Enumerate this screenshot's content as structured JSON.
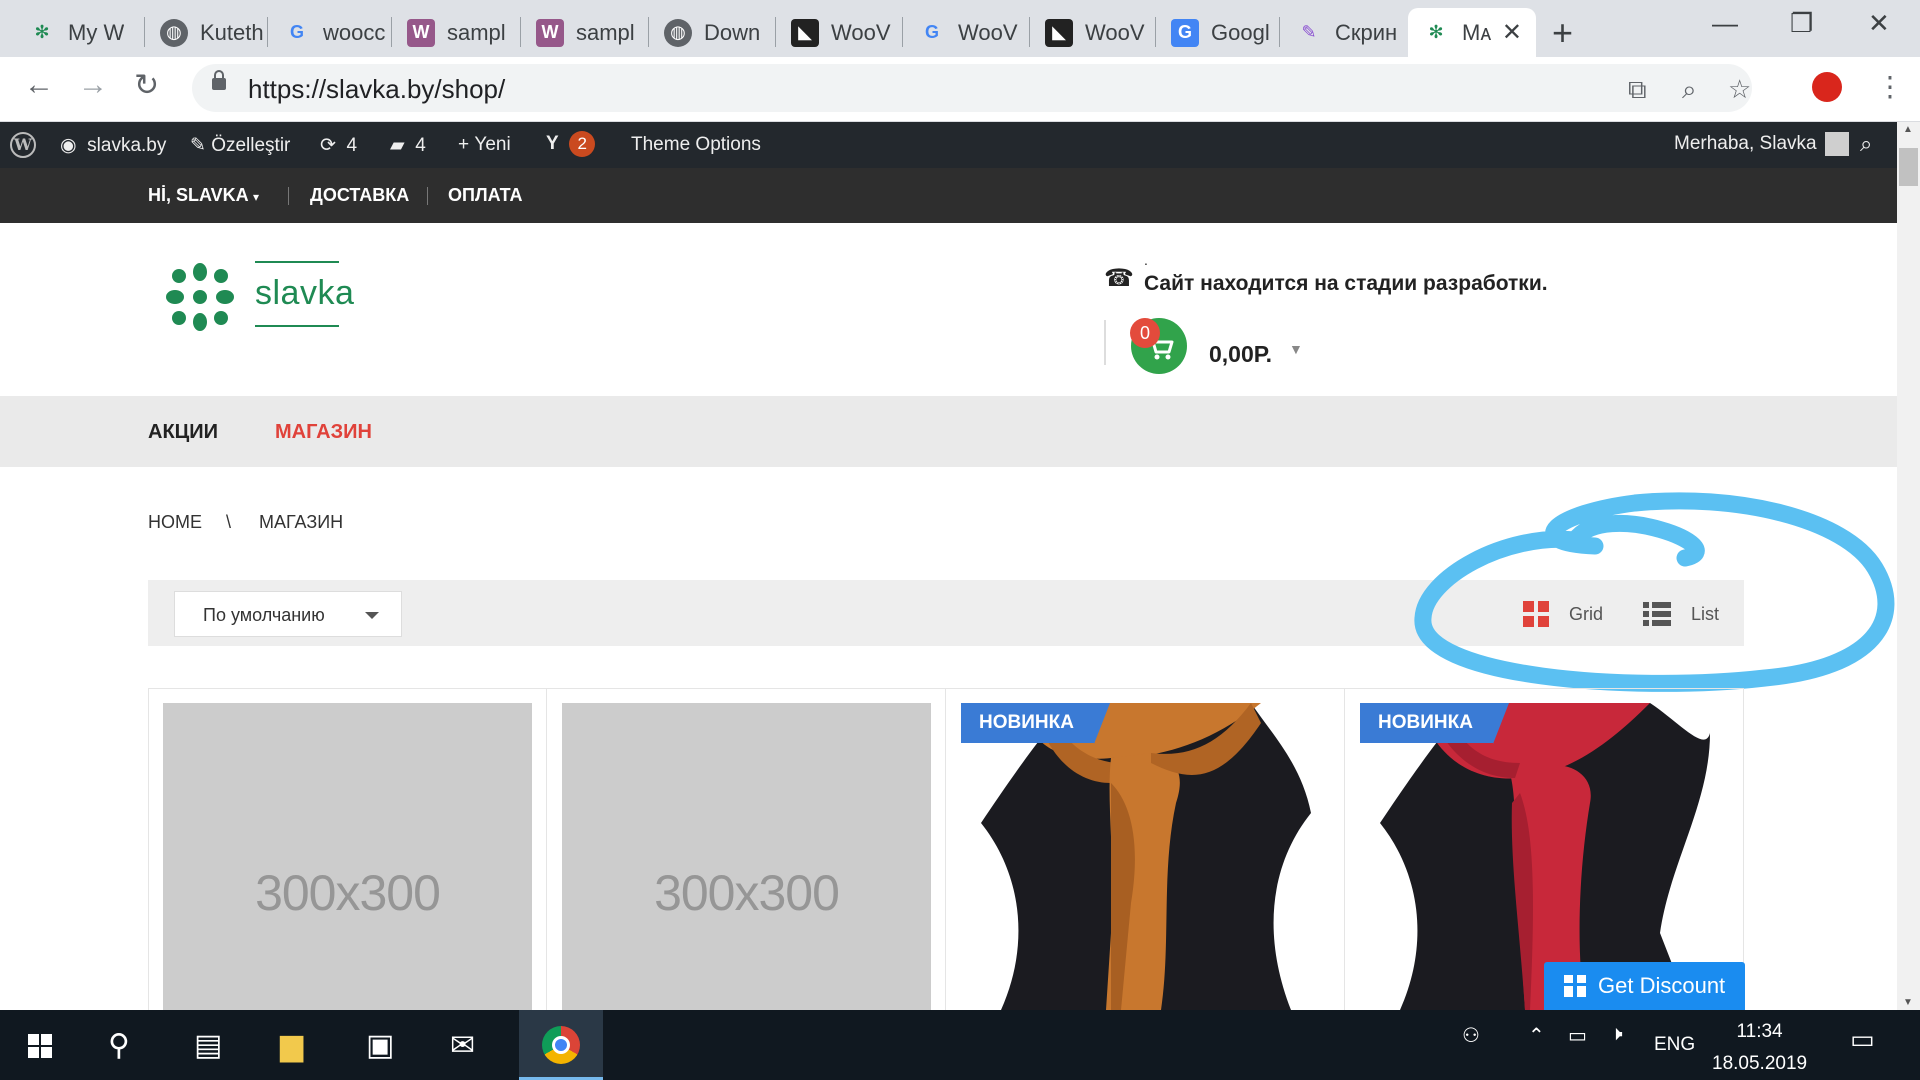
{
  "browser": {
    "tabs": [
      {
        "title": "My W",
        "favicon": "slavka-logo-icon",
        "color": "#1f8a53"
      },
      {
        "title": "Kuteth",
        "favicon": "globe-icon",
        "color": "#5f6368"
      },
      {
        "title": "woocc",
        "favicon": "google-icon",
        "color": "#4285f4"
      },
      {
        "title": "sampl",
        "favicon": "woocommerce-icon",
        "color": "#96588a"
      },
      {
        "title": "sampl",
        "favicon": "woocommerce-icon",
        "color": "#96588a"
      },
      {
        "title": "Down",
        "favicon": "globe-icon",
        "color": "#5f6368"
      },
      {
        "title": "WooV",
        "favicon": "penguin-icon",
        "color": "#222222"
      },
      {
        "title": "WooV",
        "favicon": "google-icon",
        "color": "#4285f4"
      },
      {
        "title": "WooV",
        "favicon": "penguin-icon",
        "color": "#222222"
      },
      {
        "title": "Googl",
        "favicon": "google-translate-icon",
        "color": "#4285f4"
      },
      {
        "title": "Скрин",
        "favicon": "feather-icon",
        "color": "#8a4fd1"
      },
      {
        "title": "Mᴀ",
        "favicon": "slavka-logo-icon",
        "color": "#1f8a53",
        "active": true
      }
    ],
    "url": "https://slavka.by/shop/"
  },
  "adminbar": {
    "site": "slavka.by",
    "customize": "Özelleştir",
    "updates": "4",
    "comments": "4",
    "new": "Yeni",
    "yoast_count": "2",
    "theme_options": "Theme Options",
    "greeting": "Merhaba, Slavka"
  },
  "topnav": {
    "account": "Hİ, SLAVKA",
    "delivery": "ДОСТАВКА",
    "payment": "ОПЛАТА"
  },
  "header": {
    "logo_text": "slavka",
    "notice_dot": ".",
    "notice": "Сайт находится на стадии разработки.",
    "cart_count": "0",
    "cart_total": "0,00Р."
  },
  "mainmenu": {
    "promo": "АКЦИИ",
    "shop": "МАГАЗИН",
    "shop_color": "#e0423a"
  },
  "breadcrumb": {
    "home": "HOME",
    "separator": "\\",
    "current": "МАГАЗИН"
  },
  "shop_toolbar": {
    "sort_selected": "По умолчанию",
    "grid_label": "Grid",
    "list_label": "List"
  },
  "products": [
    {
      "image": "placeholder",
      "placeholder_text": "300x300"
    },
    {
      "image": "placeholder",
      "placeholder_text": "300x300"
    },
    {
      "image": "orange-scarf",
      "badge": "НОВИНКА"
    },
    {
      "image": "red-scarf",
      "badge": "НОВИНКА"
    }
  ],
  "discount_button": "Get Discount",
  "taskbar": {
    "language": "ENG",
    "time": "11:34",
    "date": "18.05.2019"
  },
  "colors": {
    "brand_green": "#1f8a53",
    "accent_red": "#e0423a",
    "badge_blue": "#3a7bd5",
    "annotation_blue": "#5bc0f2"
  }
}
